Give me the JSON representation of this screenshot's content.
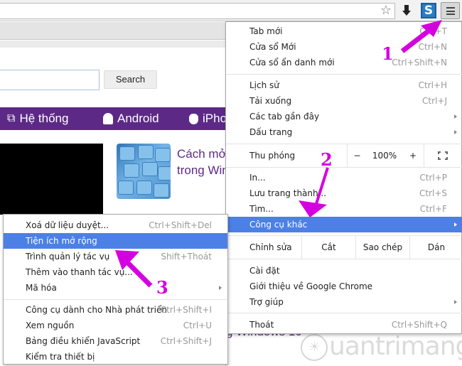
{
  "toolbar": {
    "icons": [
      "star-icon",
      "download-icon",
      "extension-s-icon",
      "menu-hamburger-icon"
    ],
    "extension_letter": "S",
    "star_glyph": "☆"
  },
  "page": {
    "search_button": "Search",
    "search_value": "",
    "nav": [
      {
        "label": "Hệ thống",
        "icon": "system-icon",
        "glyph": "⧉"
      },
      {
        "label": "Android",
        "icon": "android-icon",
        "glyph": "🤖"
      },
      {
        "label": "iPho",
        "icon": "apple-icon",
        "glyph": ""
      }
    ],
    "article_title_line1": "Cách mở",
    "article_title_line2": "trong Win",
    "article2_fragment": "g Windows 10",
    "brand_color": "#5c2a86"
  },
  "menu": {
    "group1": [
      {
        "label": "Tab mới",
        "shortcut": "Ctrl+T"
      },
      {
        "label": "Cửa sổ Mới",
        "shortcut": "Ctrl+N"
      },
      {
        "label": "Cửa sổ ẩn danh mới",
        "shortcut": "Ctrl+Shift+N"
      }
    ],
    "group2": [
      {
        "label": "Lịch sử",
        "shortcut": "Ctrl+H"
      },
      {
        "label": "Tải xuống",
        "shortcut": "Ctrl+J"
      },
      {
        "label": "Các tab gần đây",
        "submenu": true
      },
      {
        "label": "Dấu trang",
        "submenu": true
      }
    ],
    "zoom": {
      "label": "Thu phóng",
      "minus": "−",
      "value": "100%",
      "plus": "+"
    },
    "group3": [
      {
        "label": "In...",
        "shortcut": "Ctrl+P"
      },
      {
        "label": "Lưu trang thành...",
        "shortcut": "Ctrl+S"
      },
      {
        "label": "Tìm...",
        "shortcut": "Ctrl+F"
      },
      {
        "label": "Công cụ khác",
        "submenu": true,
        "active": true
      }
    ],
    "edit": {
      "label": "Chỉnh sửa",
      "cut": "Cắt",
      "copy": "Sao chép",
      "paste": "Dán"
    },
    "group4": [
      {
        "label": "Cài đặt"
      },
      {
        "label": "Giới thiệu về Google Chrome"
      },
      {
        "label": "Trợ giúp",
        "submenu": true
      }
    ],
    "exit": {
      "label": "Thoát",
      "shortcut": "Ctrl+Shift+Q"
    },
    "highlight_color": "#4c80e4"
  },
  "submenu": {
    "group1": [
      {
        "label": "Xoá dữ liệu duyệt...",
        "shortcut": "Ctrl+Shift+Del"
      },
      {
        "label": "Tiện ích mở rộng",
        "active": true
      },
      {
        "label": "Trình quản lý tác vụ",
        "shortcut": "Shift+Thoát"
      },
      {
        "label": "Thêm vào thanh tác vụ..."
      },
      {
        "label": "Mã hóa",
        "submenu": true
      }
    ],
    "group2": [
      {
        "label": "Công cụ dành cho Nhà phát triển",
        "shortcut": "Ctrl+Shift+I"
      },
      {
        "label": "Xem nguồn",
        "shortcut": "Ctrl+U"
      },
      {
        "label": "Bảng điều khiển JavaScript",
        "shortcut": "Ctrl+Shift+J"
      },
      {
        "label": "Kiểm tra thiết bị"
      }
    ]
  },
  "annotations": {
    "step1": "1",
    "step2": "2",
    "step3": "3",
    "color": "#d400e0"
  },
  "watermark": "uantrimang"
}
